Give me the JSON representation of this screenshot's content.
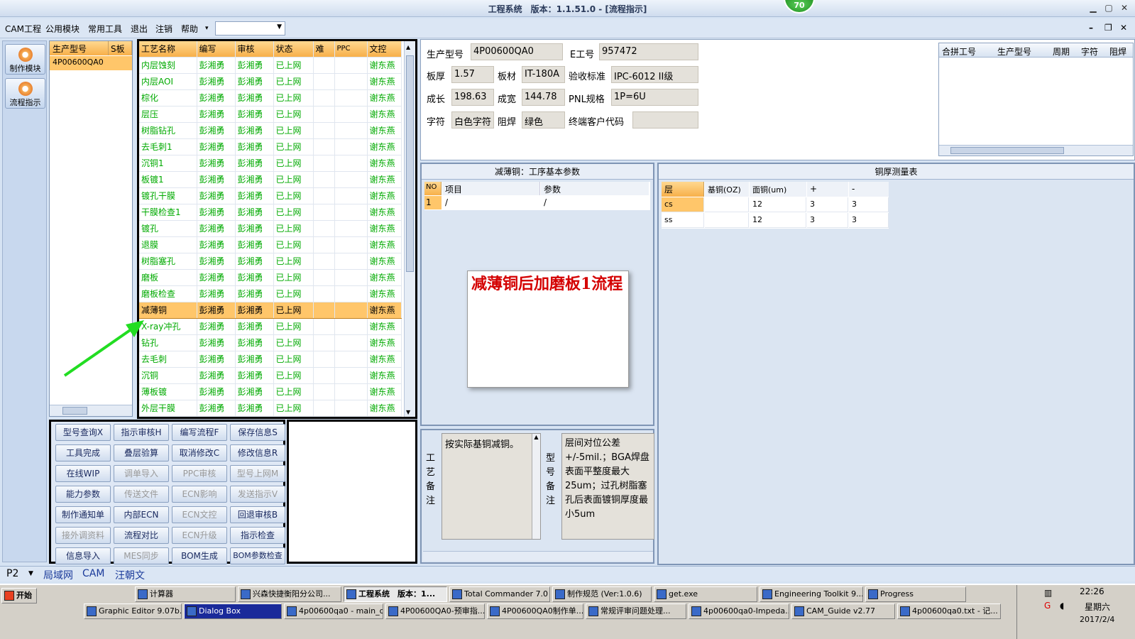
{
  "window": {
    "title": "工程系统　版本：1.1.51.0 - [流程指示]",
    "badge": "70"
  },
  "menu": {
    "items": [
      "CAM工程",
      "公用模块",
      "常用工具",
      "退出",
      "注销",
      "帮助"
    ],
    "help_arrow": "▾",
    "combo_value": ""
  },
  "leftnav": [
    {
      "label": "制作模块",
      "icon": "gear-icon"
    },
    {
      "label": "流程指示",
      "icon": "flow-icon"
    }
  ],
  "partlist": {
    "headers": [
      "生产型号",
      "S板"
    ],
    "rows": [
      "4P00600QA0"
    ]
  },
  "process": {
    "headers": [
      "工艺名称",
      "编写",
      "审核",
      "状态",
      "难",
      "PPC",
      "文控"
    ],
    "rows": [
      [
        "内层蚀刻",
        "彭湘勇",
        "彭湘勇",
        "已上网",
        "",
        "",
        "谢东燕"
      ],
      [
        "内层AOI",
        "彭湘勇",
        "彭湘勇",
        "已上网",
        "",
        "",
        "谢东燕"
      ],
      [
        "棕化",
        "彭湘勇",
        "彭湘勇",
        "已上网",
        "",
        "",
        "谢东燕"
      ],
      [
        "层压",
        "彭湘勇",
        "彭湘勇",
        "已上网",
        "",
        "",
        "谢东燕"
      ],
      [
        "树脂钻孔",
        "彭湘勇",
        "彭湘勇",
        "已上网",
        "",
        "",
        "谢东燕"
      ],
      [
        "去毛刺1",
        "彭湘勇",
        "彭湘勇",
        "已上网",
        "",
        "",
        "谢东燕"
      ],
      [
        "沉铜1",
        "彭湘勇",
        "彭湘勇",
        "已上网",
        "",
        "",
        "谢东燕"
      ],
      [
        "板镀1",
        "彭湘勇",
        "彭湘勇",
        "已上网",
        "",
        "",
        "谢东燕"
      ],
      [
        "镀孔干膜",
        "彭湘勇",
        "彭湘勇",
        "已上网",
        "",
        "",
        "谢东燕"
      ],
      [
        "干膜检查1",
        "彭湘勇",
        "彭湘勇",
        "已上网",
        "",
        "",
        "谢东燕"
      ],
      [
        "镀孔",
        "彭湘勇",
        "彭湘勇",
        "已上网",
        "",
        "",
        "谢东燕"
      ],
      [
        "退膜",
        "彭湘勇",
        "彭湘勇",
        "已上网",
        "",
        "",
        "谢东燕"
      ],
      [
        "树脂塞孔",
        "彭湘勇",
        "彭湘勇",
        "已上网",
        "",
        "",
        "谢东燕"
      ],
      [
        "磨板",
        "彭湘勇",
        "彭湘勇",
        "已上网",
        "",
        "",
        "谢东燕"
      ],
      [
        "磨板检查",
        "彭湘勇",
        "彭湘勇",
        "已上网",
        "",
        "",
        "谢东燕"
      ],
      [
        "减薄铜",
        "彭湘勇",
        "彭湘勇",
        "已上网",
        "",
        "",
        "谢东燕"
      ],
      [
        "X-ray冲孔",
        "彭湘勇",
        "彭湘勇",
        "已上网",
        "",
        "",
        "谢东燕"
      ],
      [
        "钻孔",
        "彭湘勇",
        "彭湘勇",
        "已上网",
        "",
        "",
        "谢东燕"
      ],
      [
        "去毛刺",
        "彭湘勇",
        "彭湘勇",
        "已上网",
        "",
        "",
        "谢东燕"
      ],
      [
        "沉铜",
        "彭湘勇",
        "彭湘勇",
        "已上网",
        "",
        "",
        "谢东燕"
      ],
      [
        "薄板镀",
        "彭湘勇",
        "彭湘勇",
        "已上网",
        "",
        "",
        "谢东燕"
      ],
      [
        "外层干膜",
        "彭湘勇",
        "彭湘勇",
        "已上网",
        "",
        "",
        "谢东燕"
      ]
    ],
    "selected_index": 15
  },
  "buttons": [
    {
      "label": "型号查询X",
      "enabled": true
    },
    {
      "label": "指示审核H",
      "enabled": true
    },
    {
      "label": "编写流程F",
      "enabled": true
    },
    {
      "label": "保存信息S",
      "enabled": true
    },
    {
      "label": "工具完成",
      "enabled": true
    },
    {
      "label": "叠层验算",
      "enabled": true
    },
    {
      "label": "取消修改C",
      "enabled": true
    },
    {
      "label": "修改信息R",
      "enabled": true
    },
    {
      "label": "在线WIP",
      "enabled": true
    },
    {
      "label": "调单导入",
      "enabled": false
    },
    {
      "label": "PPC审核",
      "enabled": false
    },
    {
      "label": "型号上网M",
      "enabled": false
    },
    {
      "label": "能力参数",
      "enabled": true
    },
    {
      "label": "传送文件",
      "enabled": false
    },
    {
      "label": "ECN影响",
      "enabled": false
    },
    {
      "label": "发送指示V",
      "enabled": false
    },
    {
      "label": "制作通知单",
      "enabled": true
    },
    {
      "label": "内部ECN",
      "enabled": true
    },
    {
      "label": "ECN文控",
      "enabled": false
    },
    {
      "label": "回退审核B",
      "enabled": true
    },
    {
      "label": "接外调资料",
      "enabled": false
    },
    {
      "label": "流程对比",
      "enabled": true
    },
    {
      "label": "ECN升级",
      "enabled": false
    },
    {
      "label": "指示检查",
      "enabled": true
    },
    {
      "label": "信息导入",
      "enabled": true
    },
    {
      "label": "MES同步",
      "enabled": false
    },
    {
      "label": "BOM生成",
      "enabled": true
    },
    {
      "label": "BOM参数检查",
      "enabled": true
    }
  ],
  "info": {
    "prod_model_label": "生产型号",
    "prod_model": "4P00600QA0",
    "e_no_label": "E工号",
    "e_no": "957472",
    "thick_label": "板厚",
    "thick": "1.57",
    "material_label": "板材",
    "material": "IT-180A",
    "std_label": "验收标准",
    "std": "IPC-6012 II级",
    "len_label": "成长",
    "len": "198.63",
    "wid_label": "成宽",
    "wid": "144.78",
    "pnl_label": "PNL规格",
    "pnl": "1P=6U",
    "char_label": "字符",
    "char": "白色字符",
    "mask_label": "阻焊",
    "mask": "绿色",
    "cust_label": "终端客户代码",
    "cust": ""
  },
  "grid2": {
    "headers": [
      "合拼工号",
      "生产型号",
      "周期",
      "字符",
      "阻焊"
    ]
  },
  "params": {
    "title": "减薄铜：工序基本参数",
    "headers": [
      "NO",
      "项目",
      "参数"
    ],
    "rows": [
      [
        "1",
        "/",
        "/"
      ]
    ]
  },
  "measure": {
    "title": "铜厚测量表",
    "headers": [
      "层",
      "基铜(OZ)",
      "面铜(um)",
      "+",
      "-"
    ],
    "rows": [
      [
        "cs",
        "",
        "12",
        "3",
        "3"
      ],
      [
        "ss",
        "",
        "12",
        "3",
        "3"
      ]
    ]
  },
  "popup": {
    "text": "减薄铜后加磨板1流程"
  },
  "notes": {
    "process_label": "工艺备注",
    "process_text": "按实际基铜减铜。",
    "model_label": "型号备注",
    "model_text": "层间对位公差+/-5mil.；BGA焊盘表面平整度最大25um；过孔树脂塞孔后表面镀铜厚度最小5um"
  },
  "statusbar": {
    "page": "P2",
    "items": [
      "局域网",
      "CAM",
      "汪朝文"
    ]
  },
  "taskbar": {
    "start": "开始",
    "row1": [
      "计算器",
      "兴森快捷衡阳分公司...",
      "工程系统　版本：1...",
      "Total Commander 7.0 ...",
      "制作规范 (Ver:1.0.6)",
      "get.exe",
      "Engineering Toolkit 9....",
      "Progress"
    ],
    "row2": [
      "Graphic Editor 9.07b...",
      "Dialog Box",
      "4p00600qa0 - main_qa",
      "4P00600QA0-预审指...",
      "4P00600QA0制作单....",
      "常规评审问题处理...",
      "4p00600qa0-Impeda...",
      "CAM_Guide v2.77",
      "4p00600qa0.txt - 记..."
    ],
    "clock": "22:26",
    "weekday": "星期六",
    "date": "2017/2/4"
  },
  "colors": {
    "selected": "#ffc66a",
    "header": "#f7b04a",
    "green_text": "#00aa00",
    "popup_text": "#d40000",
    "arrow": "#22dd22"
  }
}
